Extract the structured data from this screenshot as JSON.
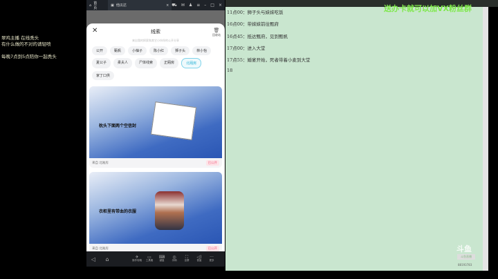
{
  "overlay_left": [
    "翠鸡主播 在线秃头",
    "有什么做的不对的请轻喷",
    "",
    "每晚7点到5点陪你一起秃头"
  ],
  "window": {
    "home_tab": "首页",
    "app_tab": "他瓜达"
  },
  "modal": {
    "title": "线索",
    "subtitle": "来自我的探索和其它小伙伴的公开分享",
    "recycle": "回收站",
    "tags": [
      "公开",
      "甄帆",
      "小柚子",
      "陈小红",
      "狮子头",
      "林小怡",
      "夏公子",
      "柔夫人",
      "尸体线索",
      "正厢房",
      "北厢房",
      "家丁口供"
    ],
    "selected_tag": "北厢房",
    "cards": [
      {
        "caption": "枕头下面两个空信封",
        "source": "来自 北厢房",
        "badge": "已公开"
      },
      {
        "caption": "衣柜里有带血的衣服",
        "source": "来自 北厢房",
        "badge": "已公开"
      }
    ]
  },
  "nav": [
    "操作攻略",
    "工具箱",
    "键盘",
    "手柄",
    "全屏",
    "音量",
    "更多"
  ],
  "notes": [
    "11点00：狮子头与妹妹吃饭",
    "16点00：带妹妹前往甄府",
    "16点45：抵达甄府，见到甄帆",
    "17点00：进入大堂",
    "17点55：婚宴开始，死者带着小麦到大堂",
    "18"
  ],
  "banner": "送办卡就可以加VX粉丝群",
  "watermark": {
    "logo": "斗鱼",
    "sub": "斗鱼直播",
    "id": "88193783"
  }
}
